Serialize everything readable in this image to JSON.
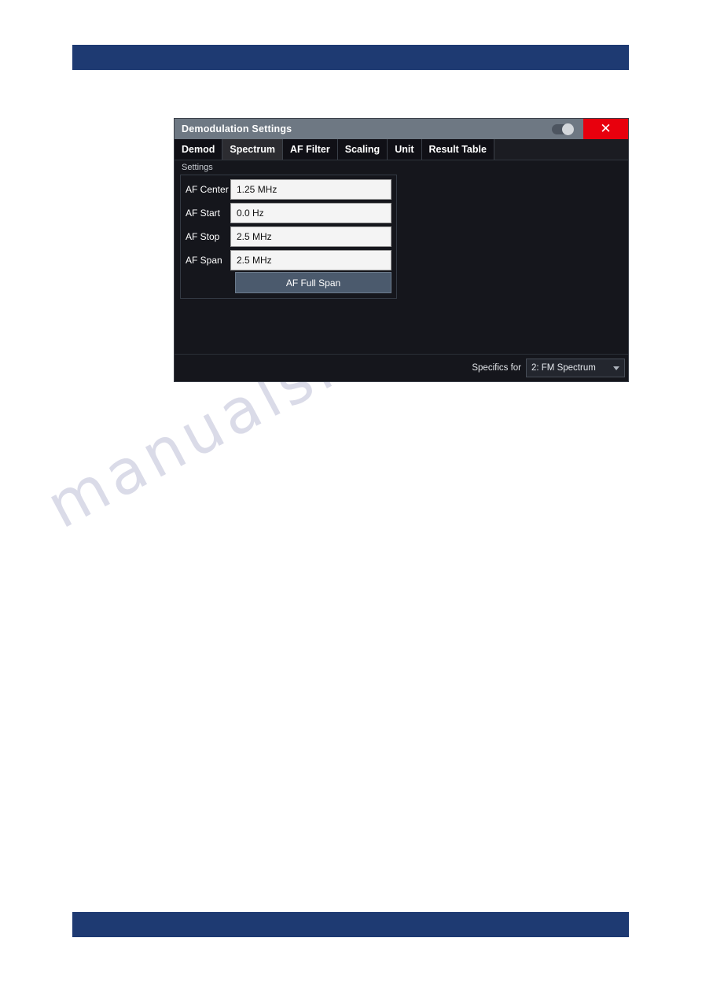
{
  "page": {
    "header_bar_color": "#1e3a72",
    "footer_bar_color": "#1e3a72",
    "watermark_text": "manualshive.com"
  },
  "dialog": {
    "title": "Demodulation Settings",
    "toggle_state": "on",
    "close_label": "✕",
    "tabs": [
      {
        "label": "Demod",
        "active": false
      },
      {
        "label": "Spectrum",
        "active": true
      },
      {
        "label": "AF Filter",
        "active": false
      },
      {
        "label": "Scaling",
        "active": false
      },
      {
        "label": "Unit",
        "active": false
      },
      {
        "label": "Result Table",
        "active": false
      }
    ],
    "settings": {
      "group_label": "Settings",
      "fields": [
        {
          "label": "AF Center",
          "value": "1.25 MHz"
        },
        {
          "label": "AF Start",
          "value": "0.0 Hz"
        },
        {
          "label": "AF Stop",
          "value": "2.5 MHz"
        },
        {
          "label": "AF Span",
          "value": "2.5 MHz"
        }
      ],
      "full_span_button": "AF Full Span"
    },
    "footer": {
      "specifics_label": "Specifics for",
      "specifics_value": "2: FM Spectrum"
    },
    "colors": {
      "titlebar": "#6e7883",
      "close_button": "#e8000d",
      "active_tab": "#2c2c31",
      "action_button": "#4b5a6d",
      "field_background": "#f4f4f4"
    }
  }
}
